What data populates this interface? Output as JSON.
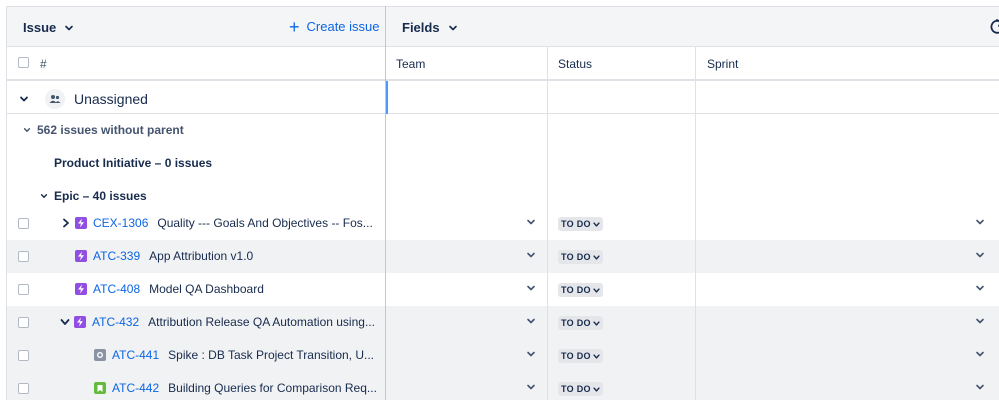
{
  "toolbar": {
    "issue_label": "Issue",
    "create_label": "Create issue",
    "fields_label": "Fields"
  },
  "header": {
    "hash": "#",
    "columns": [
      "Team",
      "Status",
      "Sprint"
    ]
  },
  "group": {
    "title": "Unassigned"
  },
  "subgroups": {
    "no_parent": "562 issues without parent",
    "product_initiative": "Product Initiative – 0 issues",
    "epic": "Epic – 40 issues"
  },
  "rows": [
    {
      "key": "CEX-1306",
      "summary": "Quality --- Goals And Objectives -- Fos...",
      "type": "epic",
      "expand": "collapsed",
      "status": "TO DO"
    },
    {
      "key": "ATC-339",
      "summary": "App Attribution v1.0",
      "type": "epic",
      "expand": "none",
      "status": "TO DO"
    },
    {
      "key": "ATC-408",
      "summary": "Model QA Dashboard",
      "type": "epic",
      "expand": "none",
      "status": "TO DO"
    },
    {
      "key": "ATC-432",
      "summary": "Attribution Release QA Automation using...",
      "type": "epic",
      "expand": "expanded",
      "status": "TO DO"
    },
    {
      "key": "ATC-441",
      "summary": "Spike : DB Task Project Transition, U...",
      "type": "task",
      "expand": "none",
      "status": "TO DO"
    },
    {
      "key": "ATC-442",
      "summary": "Building Queries for Comparison Req...",
      "type": "story",
      "expand": "none",
      "status": "TO DO"
    }
  ],
  "colors": {
    "link": "#0c66e4",
    "epic": "#904ee2",
    "story": "#63ba3c",
    "task": "#8993a4",
    "focus": "#4c9aff"
  }
}
